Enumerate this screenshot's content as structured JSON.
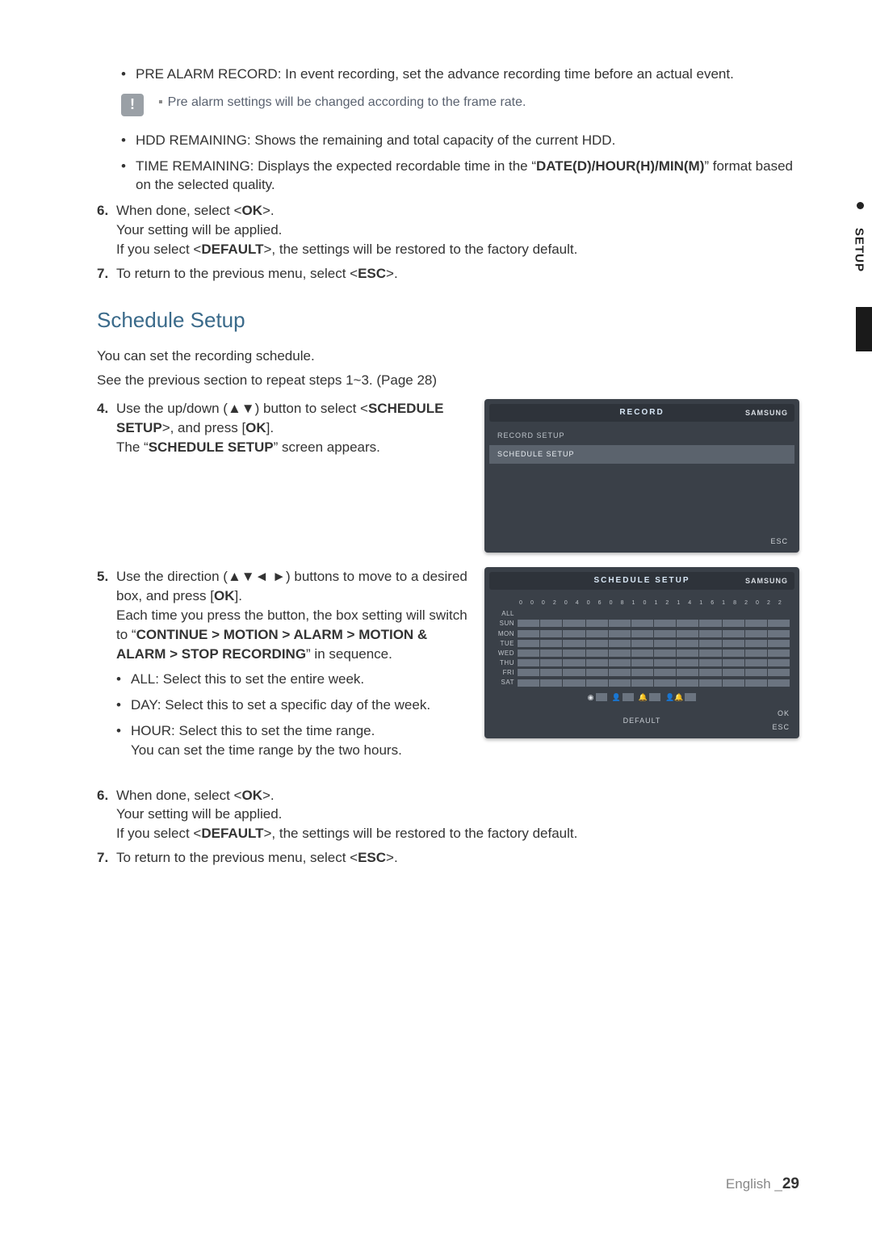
{
  "bullets_top": [
    {
      "label": "PRE ALARM RECORD",
      "desc": ": In event recording, set the advance recording time before an actual event."
    }
  ],
  "note": {
    "icon": "!",
    "text": "Pre alarm settings will be changed according to the frame rate."
  },
  "bullets_second": [
    {
      "label": "HDD REMAINING",
      "desc": ": Shows the remaining and total capacity of the current HDD."
    },
    {
      "label": "TIME REMAINING",
      "desc_pre": ": Displays the expected recordable time in the “",
      "bold": "DATE(D)/HOUR(H)/MIN(M)",
      "desc_post": "” format based on the selected quality."
    }
  ],
  "step6a": {
    "num": "6.",
    "l1a": "When done, select <",
    "l1b": "OK",
    "l1c": ">.",
    "l2": "Your setting will be applied.",
    "l3a": "If you select <",
    "l3b": "DEFAULT",
    "l3c": ">, the settings will be restored to the factory default."
  },
  "step7a": {
    "num": "7.",
    "a": "To return to the previous menu, select <",
    "b": "ESC",
    "c": ">."
  },
  "section_title": "Schedule Setup",
  "intro1": "You can set the recording schedule.",
  "intro2": "See the previous section to repeat steps 1~3. (Page 28)",
  "step4": {
    "num": "4.",
    "l1a": "Use the up/down (▲▼) button to select <",
    "l1b": "SCHEDULE SETUP",
    "l1c": ">, and press [",
    "l1d": "OK",
    "l1e": "].",
    "l2a": "The “",
    "l2b": "SCHEDULE SETUP",
    "l2c": "” screen appears."
  },
  "record_screen": {
    "title": "RECORD",
    "brand": "SAMSUNG",
    "items": [
      "RECORD SETUP",
      "SCHEDULE SETUP"
    ],
    "esc": "ESC"
  },
  "step5": {
    "num": "5.",
    "l1a": "Use the direction (▲▼◄ ►) buttons to move to a desired box, and press [",
    "l1b": "OK",
    "l1c": "].",
    "l2a": "Each time you press the button, the box setting will switch to “",
    "l2b": "CONTINUE > MOTION > ALARM > MOTION & ALARM > STOP RECORDING",
    "l2c": "” in sequence.",
    "sub": [
      "ALL: Select this to set the entire week.",
      "DAY: Select this to set a specific day of the week.",
      "HOUR: Select this to set the time range.\nYou can set the time range by the two hours."
    ]
  },
  "sched_screen": {
    "title": "SCHEDULE SETUP",
    "brand": "SAMSUNG",
    "hours": [
      "0",
      "0",
      "0",
      "2",
      "0",
      "4",
      "0",
      "6",
      "0",
      "8",
      "1",
      "0",
      "1",
      "2",
      "1",
      "4",
      "1",
      "6",
      "1",
      "8",
      "2",
      "0",
      "2",
      "2"
    ],
    "days": [
      "ALL",
      "SUN",
      "MON",
      "TUE",
      "WED",
      "THU",
      "FRI",
      "SAT"
    ],
    "ok": "OK",
    "default": "DEFAULT",
    "esc": "ESC"
  },
  "step6b": {
    "num": "6.",
    "l1a": "When done, select <",
    "l1b": "OK",
    "l1c": ">.",
    "l2": "Your setting will be applied.",
    "l3a": "If you select <",
    "l3b": "DEFAULT",
    "l3c": ">, the settings will be restored to the factory default."
  },
  "step7b": {
    "num": "7.",
    "a": "To return to the previous menu, select <",
    "b": "ESC",
    "c": ">."
  },
  "side_tab": "SETUP",
  "footer": {
    "lang": "English _",
    "page": "29"
  }
}
